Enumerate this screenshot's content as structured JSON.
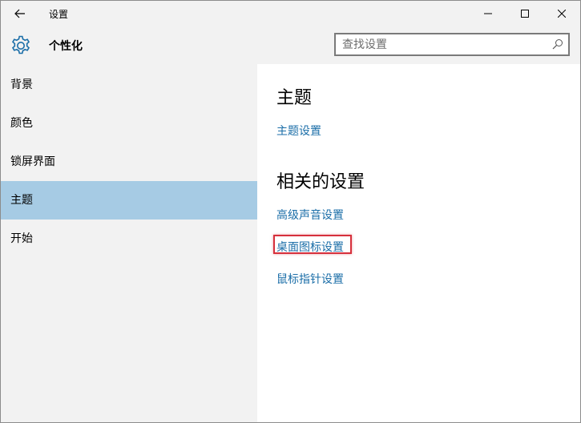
{
  "window": {
    "title": "设置",
    "controls": {
      "minimize": "minimize-icon",
      "maximize": "maximize-icon",
      "close": "close-icon"
    }
  },
  "header": {
    "icon": "gear-icon",
    "title": "个性化",
    "search": {
      "placeholder": "查找设置",
      "value": "",
      "icon": "search-icon"
    }
  },
  "sidebar": {
    "items": [
      {
        "label": "背景",
        "selected": false
      },
      {
        "label": "颜色",
        "selected": false
      },
      {
        "label": "锁屏界面",
        "selected": false
      },
      {
        "label": "主题",
        "selected": true
      },
      {
        "label": "开始",
        "selected": false
      }
    ]
  },
  "main": {
    "theme_section": {
      "title": "主题",
      "link": "主题设置"
    },
    "related_section": {
      "title": "相关的设置",
      "links": [
        "高级声音设置",
        "桌面图标设置",
        "鼠标指针设置"
      ]
    }
  },
  "colors": {
    "accent": "#1b6ea8",
    "selected_bg": "#a6cbe4",
    "sidebar_bg": "#f2f2f2",
    "highlight": "#d6303c"
  }
}
